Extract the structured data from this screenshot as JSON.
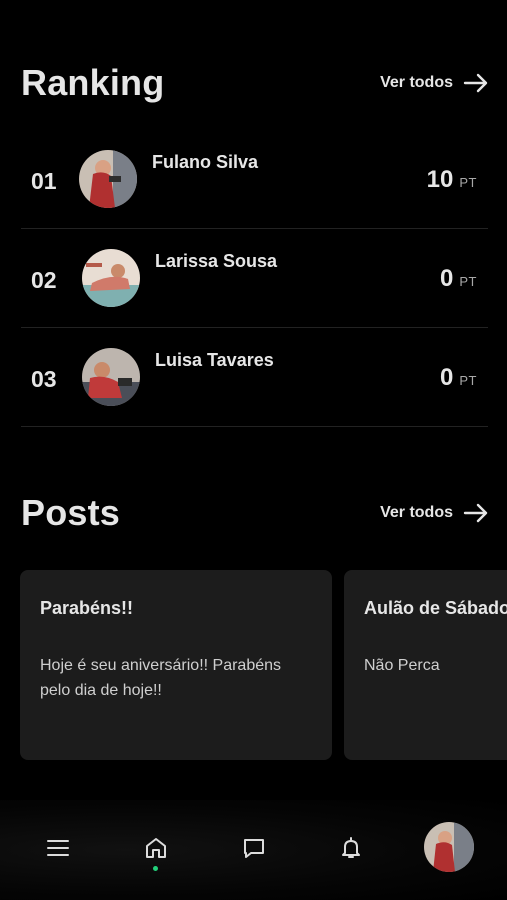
{
  "ranking": {
    "title": "Ranking",
    "see_all_label": "Ver todos",
    "entries": [
      {
        "position": "01",
        "name": "Fulano Silva",
        "points": "10",
        "unit": "PT"
      },
      {
        "position": "02",
        "name": "Larissa Sousa",
        "points": "0",
        "unit": "PT"
      },
      {
        "position": "03",
        "name": "Luisa Tavares",
        "points": "0",
        "unit": "PT"
      }
    ]
  },
  "posts": {
    "title": "Posts",
    "see_all_label": "Ver todos",
    "items": [
      {
        "title": "Parabéns!!",
        "body": "Hoje é seu aniversário!! Parabéns pelo dia de hoje!!"
      },
      {
        "title": "Aulão de Sábado",
        "body": "Não Perca"
      }
    ]
  },
  "bottom_nav": {
    "items": [
      {
        "icon": "menu-icon"
      },
      {
        "icon": "home-icon",
        "active": true
      },
      {
        "icon": "chat-icon"
      },
      {
        "icon": "bell-icon"
      },
      {
        "icon": "profile-avatar"
      }
    ],
    "active_color": "#22d07a"
  }
}
